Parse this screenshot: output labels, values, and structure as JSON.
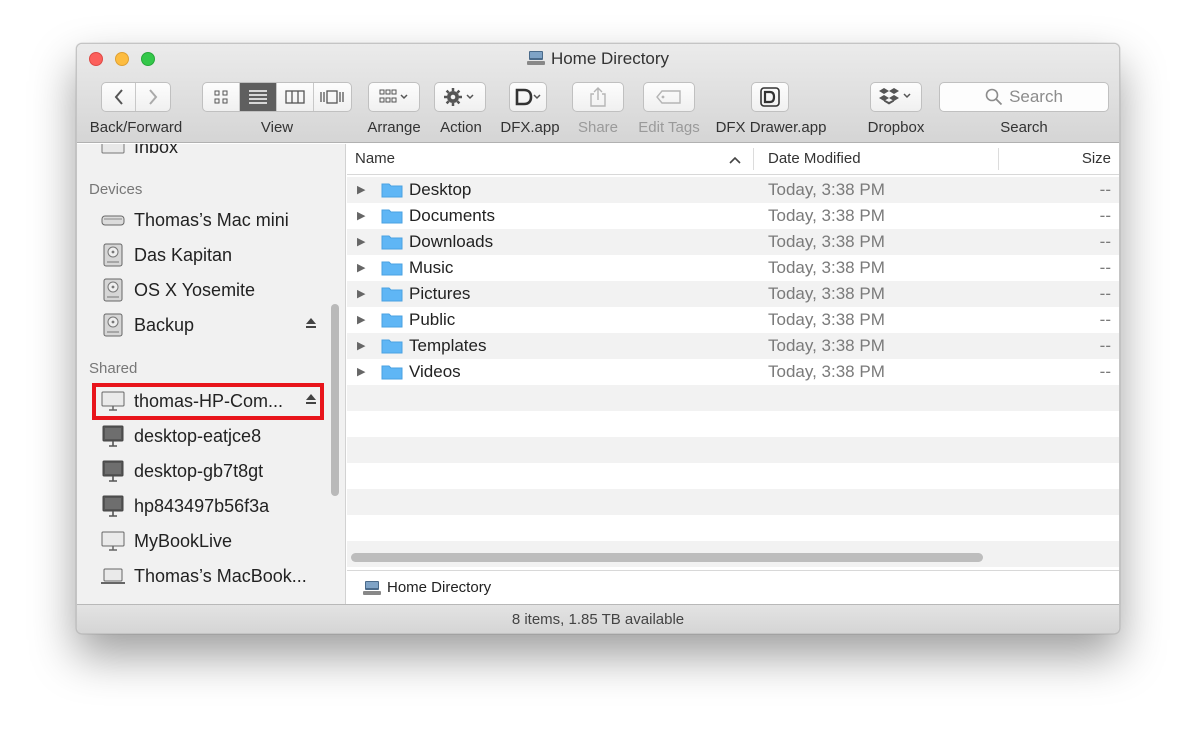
{
  "window": {
    "title": "Home Directory"
  },
  "toolbar": {
    "back_forward_label": "Back/Forward",
    "view_label": "View",
    "arrange_label": "Arrange",
    "action_label": "Action",
    "dfx_label": "DFX.app",
    "share_label": "Share",
    "edit_tags_label": "Edit Tags",
    "dfx_drawer_label": "DFX Drawer.app",
    "dropbox_label": "Dropbox",
    "search_label": "Search",
    "search_placeholder": "Search"
  },
  "sidebar": {
    "partial_item": "Inbox",
    "devices_header": "Devices",
    "devices": [
      {
        "label": "Thomas’s Mac mini"
      },
      {
        "label": "Das Kapitan"
      },
      {
        "label": "OS X Yosemite"
      },
      {
        "label": "Backup"
      }
    ],
    "shared_header": "Shared",
    "shared": [
      {
        "label": "thomas-HP-Com..."
      },
      {
        "label": "desktop-eatjce8"
      },
      {
        "label": "desktop-gb7t8gt"
      },
      {
        "label": "hp843497b56f3a"
      },
      {
        "label": "MyBookLive"
      },
      {
        "label": "Thomas’s MacBook..."
      }
    ]
  },
  "list": {
    "columns": {
      "name": "Name",
      "date": "Date Modified",
      "size": "Size"
    },
    "rows": [
      {
        "name": "Desktop",
        "date": "Today, 3:38 PM",
        "size": "--"
      },
      {
        "name": "Documents",
        "date": "Today, 3:38 PM",
        "size": "--"
      },
      {
        "name": "Downloads",
        "date": "Today, 3:38 PM",
        "size": "--"
      },
      {
        "name": "Music",
        "date": "Today, 3:38 PM",
        "size": "--"
      },
      {
        "name": "Pictures",
        "date": "Today, 3:38 PM",
        "size": "--"
      },
      {
        "name": "Public",
        "date": "Today, 3:38 PM",
        "size": "--"
      },
      {
        "name": "Templates",
        "date": "Today, 3:38 PM",
        "size": "--"
      },
      {
        "name": "Videos",
        "date": "Today, 3:38 PM",
        "size": "--"
      }
    ]
  },
  "path_bar": {
    "label": "Home Directory"
  },
  "status_bar": {
    "text": "8 items, 1.85 TB available"
  },
  "colors": {
    "highlight": "#e8141b",
    "folder": "#5fb6f5",
    "active_view": "#5f5f5f"
  }
}
